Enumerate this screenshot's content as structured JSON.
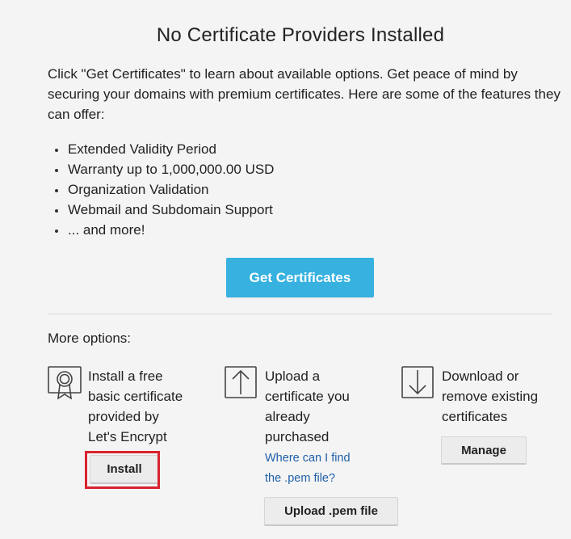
{
  "header": {
    "title": "No Certificate Providers Installed"
  },
  "intro": {
    "text": "Click \"Get Certificates\" to learn about available options. Get peace of mind by securing your domains with premium certificates. Here are some of the features they can offer:"
  },
  "features": [
    "Extended Validity Period",
    "Warranty up to 1,000,000.00 USD",
    "Organization Validation",
    "Webmail and Subdomain Support",
    "... and more!"
  ],
  "get_certificates_button": {
    "label": "Get Certificates",
    "color": "#36b1e0"
  },
  "more_options": {
    "label": "More options:",
    "options": [
      {
        "icon": "certificate-ribbon-icon",
        "lines": [
          "Install a free",
          "basic certificate",
          "provided by",
          "Let's Encrypt"
        ],
        "button_label": "Install"
      },
      {
        "icon": "upload-arrow-icon",
        "lines": [
          "Upload a",
          "certificate you",
          "already",
          "purchased"
        ],
        "link_lines": [
          "Where can I find",
          "the .pem file?"
        ],
        "button_label": "Upload .pem file"
      },
      {
        "icon": "download-arrow-icon",
        "lines": [
          "Download or",
          "remove existing",
          "certificates"
        ],
        "button_label": "Manage"
      }
    ]
  },
  "highlight_color": "#d9232f"
}
